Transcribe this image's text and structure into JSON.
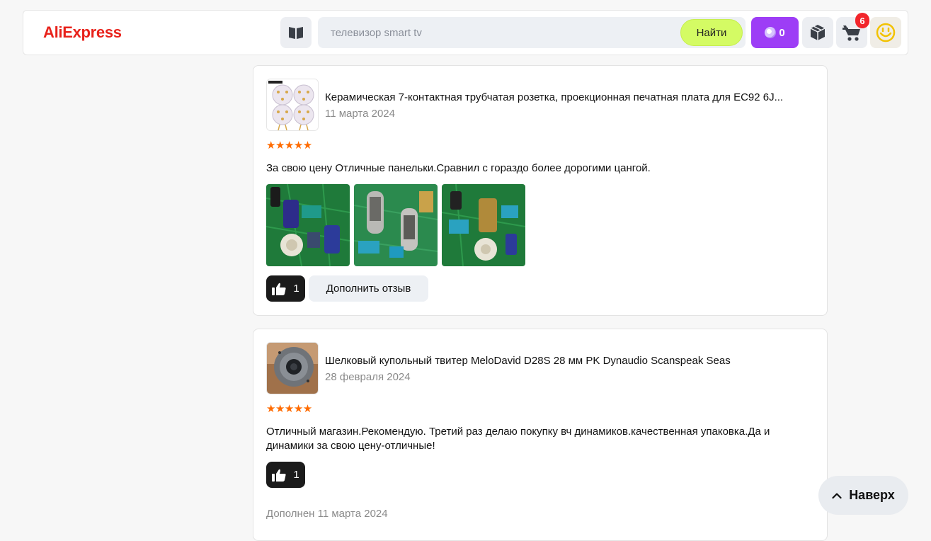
{
  "header": {
    "logo": "AliExpress",
    "search": {
      "placeholder": "телевизор smart tv",
      "button_label": "Найти"
    },
    "coins": {
      "count": "0"
    },
    "cart": {
      "badge": "6"
    }
  },
  "reviews": [
    {
      "product_title": "Керамическая 7-контактная трубчатая розетка, проекционная печатная плата для EC92 6J...",
      "date": "11 марта 2024",
      "rating": 5,
      "stars": "★★★★★",
      "text": "За свою цену Отличные панельки.Сравнил с гораздо более дорогими цангой.",
      "likes": "1",
      "add_review_label": "Дополнить отзыв"
    },
    {
      "product_title": "Шелковый купольный твитер MeloDavid D28S 28 мм PK Dynaudio Scanspeak Seas",
      "date": "28 февраля 2024",
      "rating": 5,
      "stars": "★★★★★",
      "text": "Отличный магазин.Рекомендую. Третий раз делаю покупку вч динамиков.качественная упаковка.Да и динамики за свою цену-отличные!",
      "likes": "1",
      "added_date": "Дополнен 11 марта 2024"
    }
  ],
  "scroll_top": {
    "label": "Наверх"
  },
  "colors": {
    "brand": "#e8221b",
    "search_button": "#d4fb64",
    "coins": "#9d3df6",
    "stars": "#ff6b00",
    "badge": "#f2252b"
  }
}
